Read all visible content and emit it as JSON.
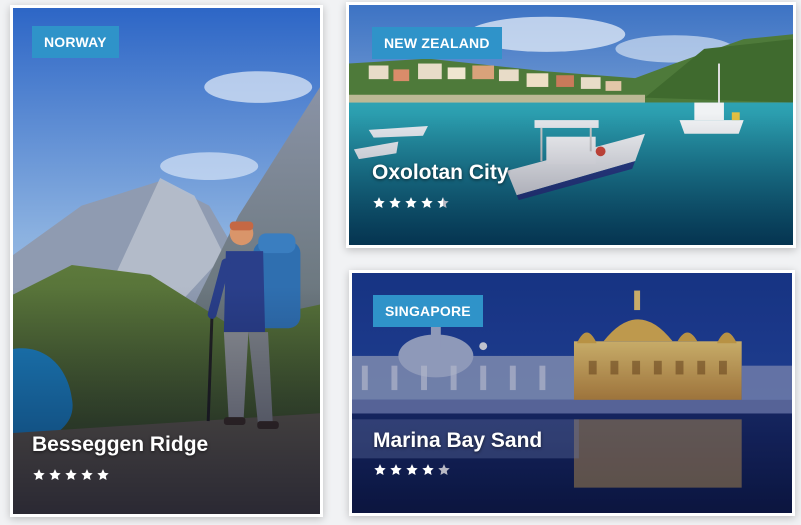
{
  "cards": [
    {
      "country": "NORWAY",
      "title": "Besseggen Ridge",
      "rating": 5
    },
    {
      "country": "NEW ZEALAND",
      "title": "Oxolotan City",
      "rating": 4.5
    },
    {
      "country": "SINGAPORE",
      "title": "Marina Bay Sand",
      "rating": 4
    }
  ],
  "colors": {
    "badge": "#2f93c9",
    "star": "#ffffff",
    "star_empty": "#b9b9c4"
  }
}
